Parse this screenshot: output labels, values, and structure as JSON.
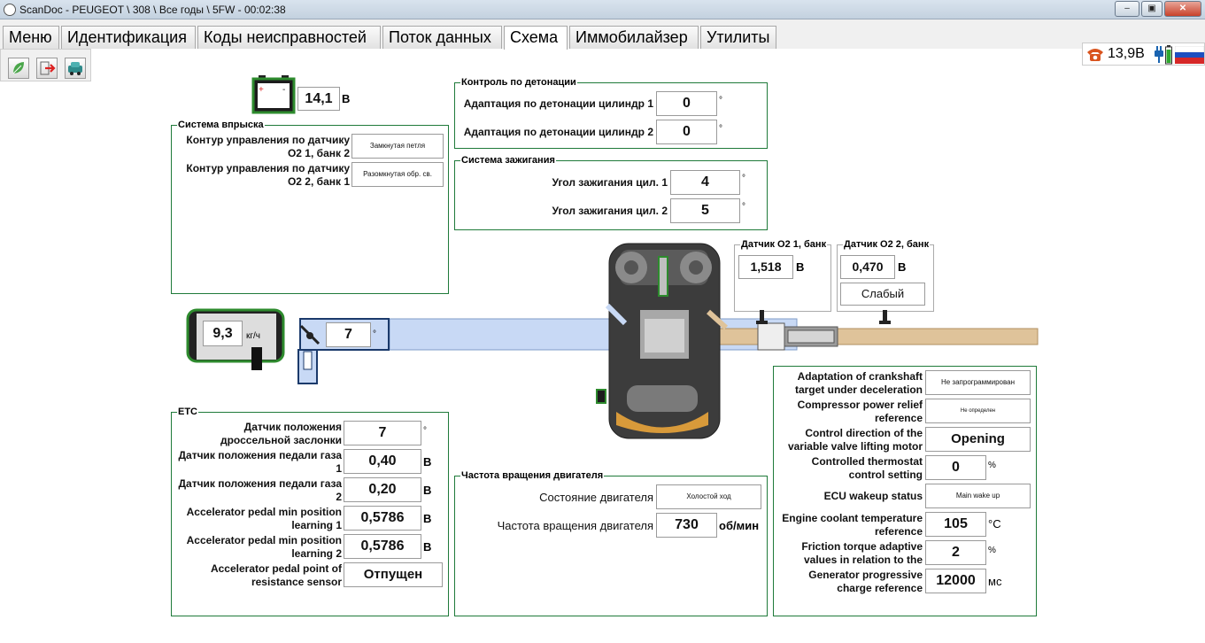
{
  "window": {
    "title": "ScanDoc - PEUGEOT \\ 308 \\ Все годы \\ 5FW - 00:02:38",
    "controls": [
      "–",
      "▣",
      "✕"
    ]
  },
  "menu": {
    "tabs": [
      "Меню",
      "Идентификация",
      "Коды неисправностей",
      "Поток данных",
      "Схема",
      "Иммобилайзер",
      "Утилиты"
    ],
    "active": "Схема"
  },
  "status": {
    "voltage": "13,9В",
    "phone_icon": "phone-icon",
    "plug_icon": "plug-icon",
    "battery_icon": "battery-icon",
    "flag_icon": "russian-flag-icon"
  },
  "toolbar": {
    "icons": [
      "leaf-icon",
      "exit-arrow-icon",
      "car-check-icon"
    ]
  },
  "battery": {
    "value": "14,1",
    "unit": "В",
    "icon": "battery-icon"
  },
  "injection": {
    "title": "Система впрыска",
    "rows": [
      {
        "label": "Контур управления по датчику О2 1, банк 2",
        "value": "Замкнутая петля"
      },
      {
        "label": "Контур управления по датчику О2 2, банк 1",
        "value": "Разомкнутая обр. св."
      }
    ]
  },
  "knock": {
    "title": "Контроль по детонации",
    "rows": [
      {
        "label": "Адаптация по детонации цилиндр 1",
        "value": "0",
        "unit": "°"
      },
      {
        "label": "Адаптация по детонации цилиндр 2",
        "value": "0",
        "unit": "°"
      }
    ]
  },
  "ignition": {
    "title": "Система зажигания",
    "rows": [
      {
        "label": "Угол зажигания цил. 1",
        "value": "4",
        "unit": "°"
      },
      {
        "label": "Угол зажигания цил. 2",
        "value": "5",
        "unit": "°"
      }
    ]
  },
  "o2_1": {
    "title": "Датчик О2 1, банк",
    "value": "1,518",
    "unit": "В"
  },
  "o2_2": {
    "title": "Датчик О2 2, банк",
    "value": "0,470",
    "unit": "В",
    "state": "Слабый"
  },
  "maf": {
    "value": "9,3",
    "unit": "кг/ч"
  },
  "throttle_diagram": {
    "value": "7",
    "unit": "°"
  },
  "etc": {
    "title": "ETC",
    "rows": [
      {
        "label": "Датчик положения дроссельной заслонки",
        "value": "7",
        "unit": "°"
      },
      {
        "label": "Датчик положения педали газа 1",
        "value": "0,40",
        "unit": "В"
      },
      {
        "label": "Датчик положения педали газа 2",
        "value": "0,20",
        "unit": "В"
      },
      {
        "label": "Accelerator pedal min position learning 1",
        "value": "0,5786",
        "unit": "В"
      },
      {
        "label": "Accelerator pedal min position learning 2",
        "value": "0,5786",
        "unit": "В"
      },
      {
        "label": "Accelerator pedal point of resistance sensor",
        "value": "Отпущен",
        "unit": ""
      }
    ]
  },
  "rpm": {
    "title": "Частота вращения двигателя",
    "rows": [
      {
        "label": "Состояние двигателя",
        "value": "Холостой ход",
        "unit": ""
      },
      {
        "label": "Частота вращения двигателя",
        "value": "730",
        "unit": "об/мин"
      }
    ]
  },
  "extra": {
    "rows": [
      {
        "label": "Adaptation of crankshaft target under deceleration",
        "value": "Не запрограммирован",
        "unit": ""
      },
      {
        "label": "Compressor power relief reference",
        "value": "Не определен",
        "unit": ""
      },
      {
        "label": "Control direction of the variable valve lifting motor",
        "value": "Opening",
        "unit": ""
      },
      {
        "label": "Controlled thermostat control setting",
        "value": "0",
        "unit": "%"
      },
      {
        "label": "ECU wakeup status",
        "value": "Main wake up",
        "unit": ""
      },
      {
        "label": "Engine coolant temperature reference",
        "value": "105",
        "unit": "°C"
      },
      {
        "label": "Friction torque adaptive values in relation to the",
        "value": "2",
        "unit": "%"
      },
      {
        "label": "Generator progressive charge reference",
        "value": "12000",
        "unit": "мс"
      }
    ]
  },
  "colors": {
    "frame": "#1f7a3a",
    "intake": "#c8d9f5",
    "exhaust": "#dfc39a",
    "accent": "#1b3a6b"
  }
}
